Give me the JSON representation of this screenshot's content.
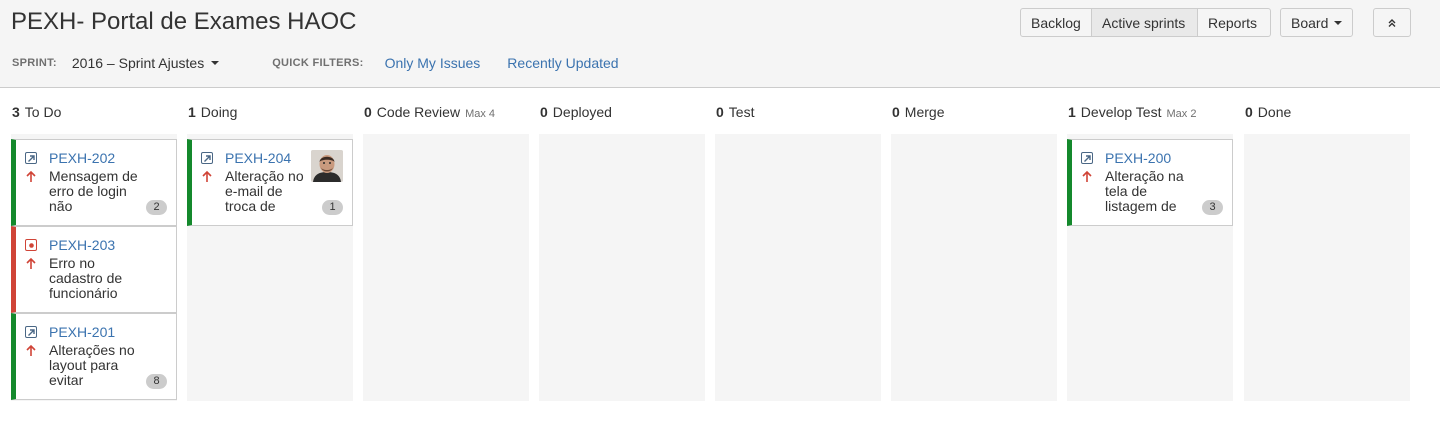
{
  "header": {
    "title": "PEXH- Portal de Exames HAOC",
    "sprint_label": "SPRINT:",
    "sprint_value": "2016 – Sprint Ajustes",
    "quick_filters_label": "QUICK FILTERS:",
    "quick_filters": [
      "Only My Issues",
      "Recently Updated"
    ],
    "nav_buttons": [
      "Backlog",
      "Active sprints",
      "Reports"
    ],
    "active_nav": "Active sprints",
    "board_button": "Board"
  },
  "colors": {
    "story": "#14892c",
    "bug": "#d04437",
    "link": "#3b73af",
    "priority": "#d04437"
  },
  "columns": [
    {
      "name": "To Do",
      "count": "3",
      "max": ""
    },
    {
      "name": "Doing",
      "count": "1",
      "max": ""
    },
    {
      "name": "Code Review",
      "count": "0",
      "max": "Max 4"
    },
    {
      "name": "Deployed",
      "count": "0",
      "max": ""
    },
    {
      "name": "Test",
      "count": "0",
      "max": ""
    },
    {
      "name": "Merge",
      "count": "0",
      "max": ""
    },
    {
      "name": "Develop Test",
      "count": "1",
      "max": "Max 2"
    },
    {
      "name": "Done",
      "count": "0",
      "max": ""
    }
  ],
  "cards": {
    "c202": {
      "key": "PEXH-202",
      "summary": "Mensagem de erro de login não",
      "badge": "2",
      "type_icon": "improvement-icon",
      "priority_icon": "priority-major-icon"
    },
    "c203": {
      "key": "PEXH-203",
      "summary": "Erro no cadastro de funcionário",
      "badge": "",
      "type_icon": "bug-icon",
      "priority_icon": "priority-major-icon"
    },
    "c201": {
      "key": "PEXH-201",
      "summary": "Alterações no layout para evitar",
      "badge": "8",
      "type_icon": "improvement-icon",
      "priority_icon": "priority-major-icon"
    },
    "c204": {
      "key": "PEXH-204",
      "summary": "Alteração no e-mail de troca de",
      "badge": "1",
      "type_icon": "improvement-icon",
      "priority_icon": "priority-major-icon"
    },
    "c200": {
      "key": "PEXH-200",
      "summary": "Alteração na tela de listagem de",
      "badge": "3",
      "type_icon": "improvement-icon",
      "priority_icon": "priority-major-icon"
    }
  }
}
